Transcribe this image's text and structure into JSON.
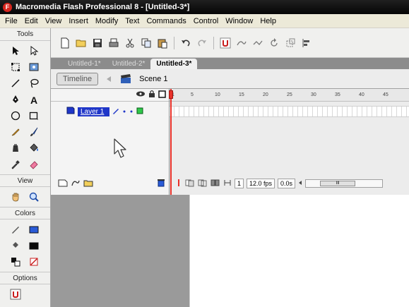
{
  "window": {
    "title": "Macromedia Flash Professional 8 - [Untitled-3*]",
    "app_icon_glyph": "F",
    "app_icon_color": "#d8261e"
  },
  "menu": {
    "items": [
      "File",
      "Edit",
      "View",
      "Insert",
      "Modify",
      "Text",
      "Commands",
      "Control",
      "Window",
      "Help"
    ]
  },
  "tools_panel": {
    "header": "Tools",
    "tools": [
      {
        "name": "selection-arrow-icon"
      },
      {
        "name": "subselection-arrow-icon"
      },
      {
        "name": "free-transform-icon"
      },
      {
        "name": "gradient-transform-icon"
      },
      {
        "name": "line-tool-icon"
      },
      {
        "name": "lasso-tool-icon"
      },
      {
        "name": "pen-tool-icon"
      },
      {
        "name": "text-tool-icon"
      },
      {
        "name": "oval-tool-icon"
      },
      {
        "name": "rectangle-tool-icon"
      },
      {
        "name": "pencil-tool-icon"
      },
      {
        "name": "brush-tool-icon"
      },
      {
        "name": "ink-bottle-icon"
      },
      {
        "name": "paint-bucket-icon"
      },
      {
        "name": "eyedropper-icon"
      },
      {
        "name": "eraser-icon"
      }
    ],
    "view_header": "View",
    "view_tools": [
      {
        "name": "hand-tool-icon"
      },
      {
        "name": "zoom-tool-icon"
      }
    ],
    "colors_header": "Colors",
    "stroke_color": "#0a0a0a",
    "fill_color": "#2a5bd7",
    "options_header": "Options"
  },
  "toolbar": {
    "buttons": [
      {
        "name": "new-file-icon"
      },
      {
        "name": "open-folder-icon"
      },
      {
        "name": "save-icon"
      },
      {
        "name": "print-icon"
      },
      {
        "name": "cut-icon"
      },
      {
        "name": "copy-icon"
      },
      {
        "name": "paste-icon"
      },
      {
        "name": "undo-icon"
      },
      {
        "name": "redo-icon"
      },
      {
        "name": "snap-magnet-icon"
      },
      {
        "name": "smooth-icon"
      },
      {
        "name": "straighten-icon"
      },
      {
        "name": "rotate-icon"
      },
      {
        "name": "scale-icon"
      },
      {
        "name": "align-icon"
      }
    ]
  },
  "document": {
    "tabs": [
      {
        "label": "Untitled-1*",
        "active": false
      },
      {
        "label": "Untitled-2*",
        "active": false
      },
      {
        "label": "Untitled-3*",
        "active": true
      }
    ],
    "timeline_button": "Timeline",
    "scene_label": "Scene 1"
  },
  "timeline": {
    "frame_numbers": [
      "1",
      "5",
      "10",
      "15",
      "20",
      "25",
      "30",
      "35",
      "40",
      "45"
    ],
    "layer": {
      "name": "Layer 1"
    },
    "current_frame": "1",
    "fps": "12.0 fps",
    "elapsed": "0.0s",
    "scroll_thumb_label": "III"
  },
  "colors": {
    "playhead": "#e8322a",
    "layer_selection": "#1f36c8",
    "stage": "#ffffff",
    "workarea": "#9a9a9a"
  }
}
